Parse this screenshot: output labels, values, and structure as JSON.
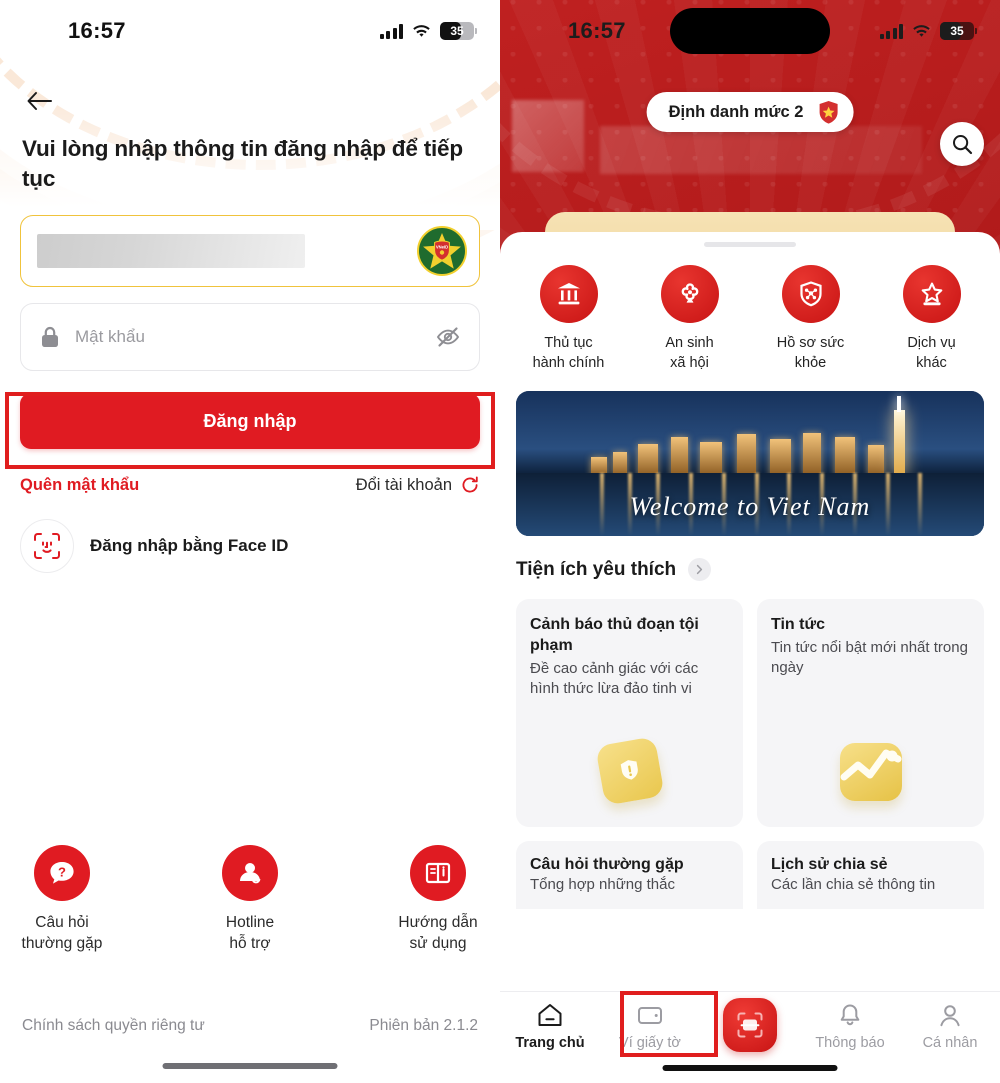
{
  "colors": {
    "brand_red": "#e01b22",
    "deep_red": "#b71c1c",
    "gold": "#f0c33c",
    "highlight": "#e01e1e"
  },
  "left": {
    "status": {
      "time": "16:57",
      "battery": "35",
      "signal_icon": "signal-bars-icon",
      "wifi_icon": "wifi-icon",
      "battery_icon": "battery-icon"
    },
    "back_icon": "back-arrow-icon",
    "title": "Vui lòng nhập thông tin đăng nhập để tiếp tục",
    "username": {
      "value": "",
      "redacted": true,
      "logo_icon": "vneid-emblem-icon"
    },
    "password": {
      "placeholder": "Mật khẩu",
      "value": "",
      "lock_icon": "lock-icon",
      "toggle_icon": "eye-off-icon"
    },
    "login_button": "Đăng nhập",
    "forgot_password": "Quên mật khẩu",
    "switch_account": {
      "label": "Đổi tài khoản",
      "icon": "refresh-icon"
    },
    "face_id": {
      "label": "Đăng nhập bằng Face ID",
      "icon": "face-id-icon"
    },
    "help": [
      {
        "label": "Câu hỏi\nthường gặp",
        "line1": "Câu hỏi",
        "line2": "thường gặp",
        "icon": "question-bubble-icon"
      },
      {
        "label": "Hotline\nhỗ trợ",
        "line1": "Hotline",
        "line2": "hỗ trợ",
        "icon": "headset-support-icon"
      },
      {
        "label": "Hướng dẫn\nsử dụng",
        "line1": "Hướng dẫn",
        "line2": "sử dụng",
        "icon": "book-guide-icon"
      }
    ],
    "privacy_policy": "Chính sách quyền riêng tư",
    "version": "Phiên bản 2.1.2"
  },
  "right": {
    "status": {
      "time": "16:57",
      "battery": "35"
    },
    "identity_badge": {
      "label": "Định danh mức 2",
      "icon": "shield-star-icon"
    },
    "search_icon": "search-icon",
    "services": [
      {
        "label1": "Thủ tục",
        "label2": "hành chính",
        "icon": "bank-columns-icon"
      },
      {
        "label1": "An sinh",
        "label2": "xã hội",
        "icon": "lotus-person-icon"
      },
      {
        "label1": "Hồ sơ sức",
        "label2": "khỏe",
        "icon": "health-shield-icon"
      },
      {
        "label1": "Dịch vụ",
        "label2": "khác",
        "icon": "star-services-icon"
      }
    ],
    "banner": {
      "text": "Welcome to Viet Nam"
    },
    "section": {
      "title": "Tiện ích yêu thích",
      "chevron_icon": "chevron-right-icon"
    },
    "cards": [
      {
        "title": "Cảnh báo thủ đoạn tội phạm",
        "desc": "Đề cao cảnh giác với các hình thức lừa đảo tinh vi",
        "icon": "warning-shield-illustration"
      },
      {
        "title": "Tin tức",
        "desc": "Tin tức nổi bật mới nhất trong ngày",
        "icon": "news-illustration"
      }
    ],
    "cards2": [
      {
        "title": "Câu hỏi thường gặp",
        "desc": "Tổng hợp những thắc"
      },
      {
        "title": "Lịch sử chia sẻ",
        "desc": "Các lần chia sẻ thông tin"
      }
    ],
    "tabs": [
      {
        "label": "Trang chủ",
        "icon": "home-icon",
        "active": true
      },
      {
        "label": "Ví giấy tờ",
        "icon": "wallet-icon",
        "active": false
      },
      {
        "label": "Thông báo",
        "icon": "bell-icon",
        "active": false
      },
      {
        "label": "Cá nhân",
        "icon": "person-icon",
        "active": false
      }
    ],
    "scan_icon": "scan-id-icon"
  }
}
